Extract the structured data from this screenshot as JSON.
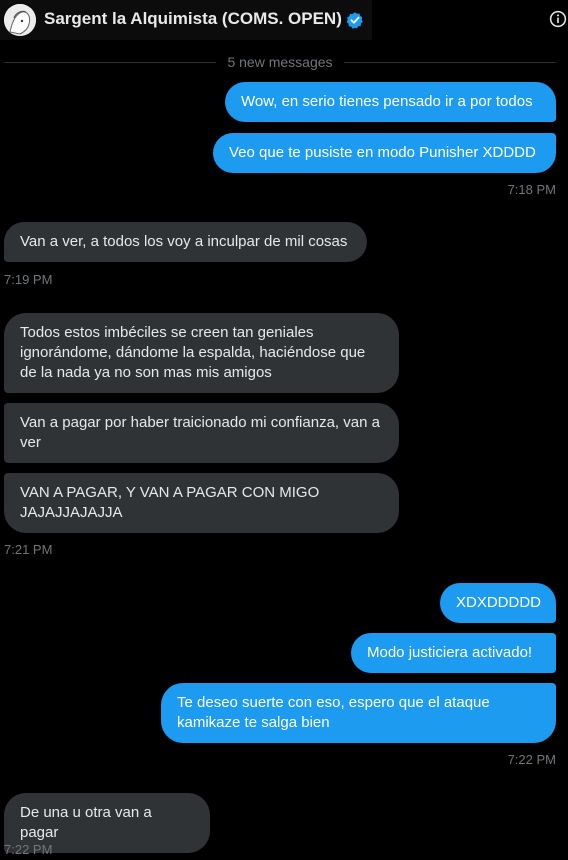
{
  "header": {
    "title": "Sargent la Alquimista (COMS. OPEN)",
    "verified_icon": "verified-badge-icon",
    "info_icon": "info-icon"
  },
  "divider": {
    "label": "5 new messages"
  },
  "messages": [
    {
      "dir": "sent",
      "text": "Wow, en serio tienes pensado ir a por todos"
    },
    {
      "dir": "sent",
      "text": "Veo que te pusiste en modo Punisher XDDDD",
      "time": "7:18 PM"
    },
    {
      "dir": "recv",
      "text": "Van a ver, a todos los voy a inculpar de mil cosas",
      "time": "7:19 PM"
    },
    {
      "dir": "recv",
      "text": "Todos estos imbéciles se creen tan geniales ignorándome, dándome la espalda, haciéndose que de la nada ya no son mas mis amigos"
    },
    {
      "dir": "recv",
      "text": "Van a pagar por haber traicionado mi confianza, van a ver"
    },
    {
      "dir": "recv",
      "text": "VAN A PAGAR, Y VAN A PAGAR CON MIGO JAJAJJAJAJJA",
      "time": "7:21 PM"
    },
    {
      "dir": "sent",
      "text": "XDXDDDDD"
    },
    {
      "dir": "sent",
      "text": "Modo justiciera activado!"
    },
    {
      "dir": "sent",
      "text": "Te deseo suerte con eso, espero que el ataque kamikaze te salga bien",
      "time": "7:22 PM"
    },
    {
      "dir": "recv",
      "text": "De una u otra van a pagar",
      "time": "7:22 PM"
    }
  ],
  "colors": {
    "sent": "#1d9bf0",
    "received": "#2f3336",
    "background": "#000000"
  }
}
